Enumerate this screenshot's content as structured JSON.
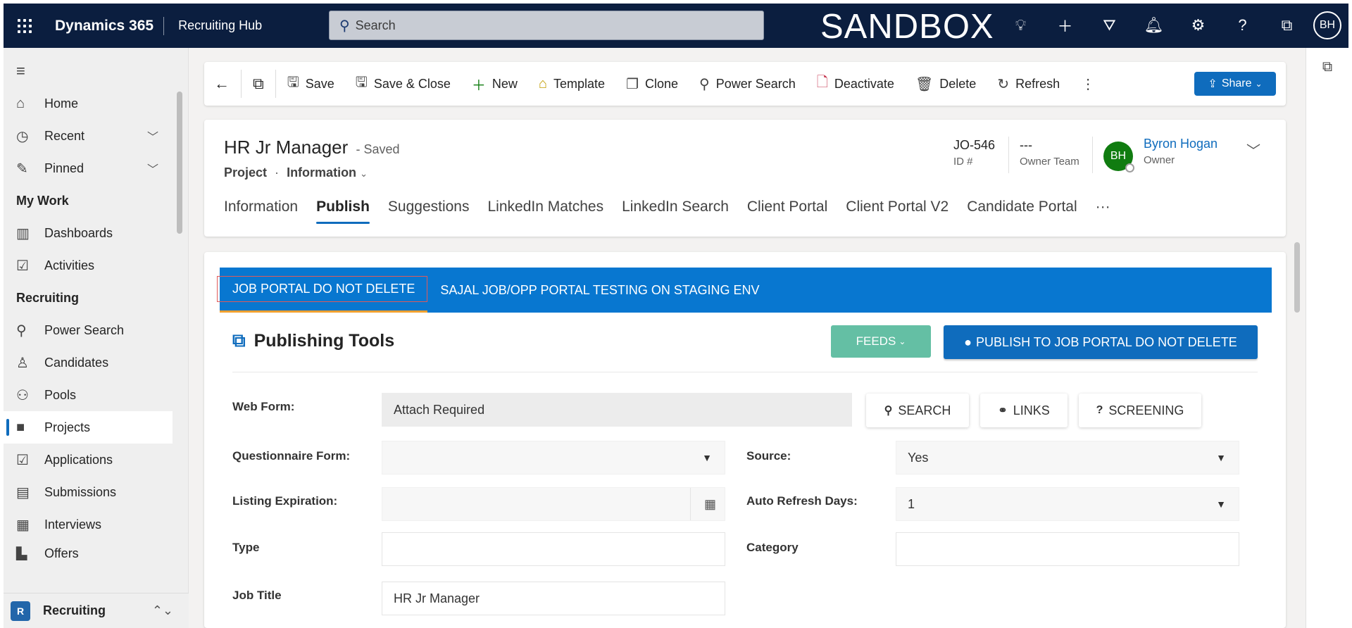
{
  "topbar": {
    "app_name": "Dynamics 365",
    "area": "Recruiting Hub",
    "search_placeholder": "Search",
    "env_label": "SANDBOX",
    "user_initials": "BH"
  },
  "sidebar": {
    "items_top": [
      {
        "label": "Home",
        "icon": "home-icon"
      },
      {
        "label": "Recent",
        "icon": "clock-icon"
      },
      {
        "label": "Pinned",
        "icon": "pin-icon"
      }
    ],
    "my_work_title": "My Work",
    "my_work": [
      {
        "label": "Dashboards",
        "icon": "dashboard-icon"
      },
      {
        "label": "Activities",
        "icon": "clipboard-icon"
      }
    ],
    "recruiting_title": "Recruiting",
    "recruiting": [
      {
        "label": "Power Search",
        "icon": "search-icon"
      },
      {
        "label": "Candidates",
        "icon": "person-icon"
      },
      {
        "label": "Pools",
        "icon": "people-icon"
      },
      {
        "label": "Projects",
        "icon": "briefcase-icon"
      },
      {
        "label": "Applications",
        "icon": "check-icon"
      },
      {
        "label": "Submissions",
        "icon": "idcard-icon"
      },
      {
        "label": "Interviews",
        "icon": "calendar-icon"
      },
      {
        "label": "Offers",
        "icon": "document-icon"
      }
    ],
    "area_switcher": {
      "badge": "R",
      "label": "Recruiting"
    }
  },
  "commandbar": {
    "save": "Save",
    "save_close": "Save & Close",
    "new": "New",
    "template": "Template",
    "clone": "Clone",
    "power_search": "Power Search",
    "deactivate": "Deactivate",
    "delete": "Delete",
    "refresh": "Refresh",
    "share": "Share"
  },
  "record": {
    "title": "HR Jr Manager",
    "status": "- Saved",
    "entity": "Project",
    "form": "Information",
    "id_value": "JO-546",
    "id_label": "ID #",
    "owner_team_value": "---",
    "owner_team_label": "Owner Team",
    "owner_initials": "BH",
    "owner_name": "Byron Hogan",
    "owner_label": "Owner",
    "tabs": [
      "Information",
      "Publish",
      "Suggestions",
      "LinkedIn Matches",
      "LinkedIn Search",
      "Client Portal",
      "Client Portal V2",
      "Candidate Portal"
    ],
    "active_tab": "Publish"
  },
  "publish": {
    "portal_tabs": [
      "JOB PORTAL DO NOT DELETE",
      "SAJAL JOB/OPP PORTAL TESTING ON STAGING ENV"
    ],
    "title": "Publishing Tools",
    "feeds": "FEEDS",
    "publish_btn": "PUBLISH TO JOB PORTAL DO NOT DELETE",
    "web_form_label": "Web Form:",
    "web_form_value": "Attach Required",
    "search_btn": "SEARCH",
    "links_btn": "LINKS",
    "screening_btn": "SCREENING",
    "questionnaire_label": "Questionnaire Form:",
    "questionnaire_value": "",
    "source_label": "Source:",
    "source_value": "Yes",
    "listing_exp_label": "Listing Expiration:",
    "listing_exp_value": "",
    "auto_refresh_label": "Auto Refresh Days:",
    "auto_refresh_value": "1",
    "type_label": "Type",
    "type_value": "",
    "category_label": "Category",
    "category_value": "",
    "job_title_label": "Job Title",
    "job_title_value": "HR Jr Manager"
  }
}
